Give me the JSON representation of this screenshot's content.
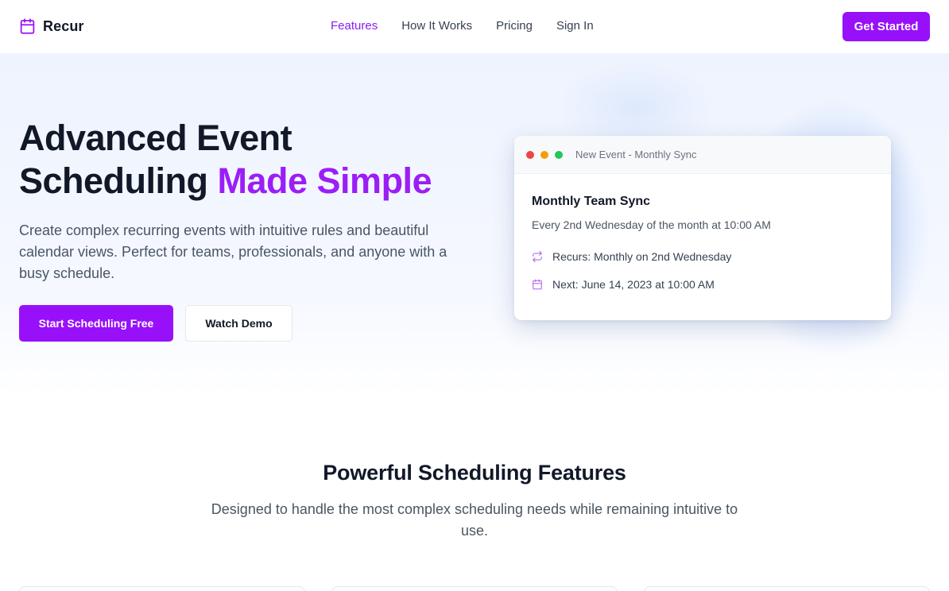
{
  "nav": {
    "brand": "Recur",
    "links": [
      "Features",
      "How It Works",
      "Pricing",
      "Sign In"
    ],
    "active_link": "Features",
    "cta": "Get Started"
  },
  "hero": {
    "title_line1": "Advanced Event",
    "title_line2_plain": "Scheduling ",
    "title_line2_accent": "Made Simple",
    "subtitle": "Create complex recurring events with intuitive rules and beautiful calendar views. Perfect for teams, professionals, and anyone with a busy schedule.",
    "primary_button": "Start Scheduling Free",
    "secondary_button": "Watch Demo"
  },
  "event_card": {
    "window_title": "New Event - Monthly Sync",
    "title": "Monthly Team Sync",
    "description": "Every 2nd Wednesday of the month at 10:00 AM",
    "recurs": "Recurs: Monthly on 2nd Wednesday",
    "next": "Next: June 14, 2023 at 10:00 AM",
    "icons": [
      "repeat-icon",
      "calendar-icon"
    ]
  },
  "features": {
    "title": "Powerful Scheduling Features",
    "subtitle": "Designed to handle the most complex scheduling needs while remaining intuitive to use."
  },
  "colors": {
    "accent": "#9810fa",
    "accent_text": "#9b1ef6",
    "dot_red": "#ef4444",
    "dot_yellow": "#f59e0b",
    "dot_green": "#22c55e"
  }
}
